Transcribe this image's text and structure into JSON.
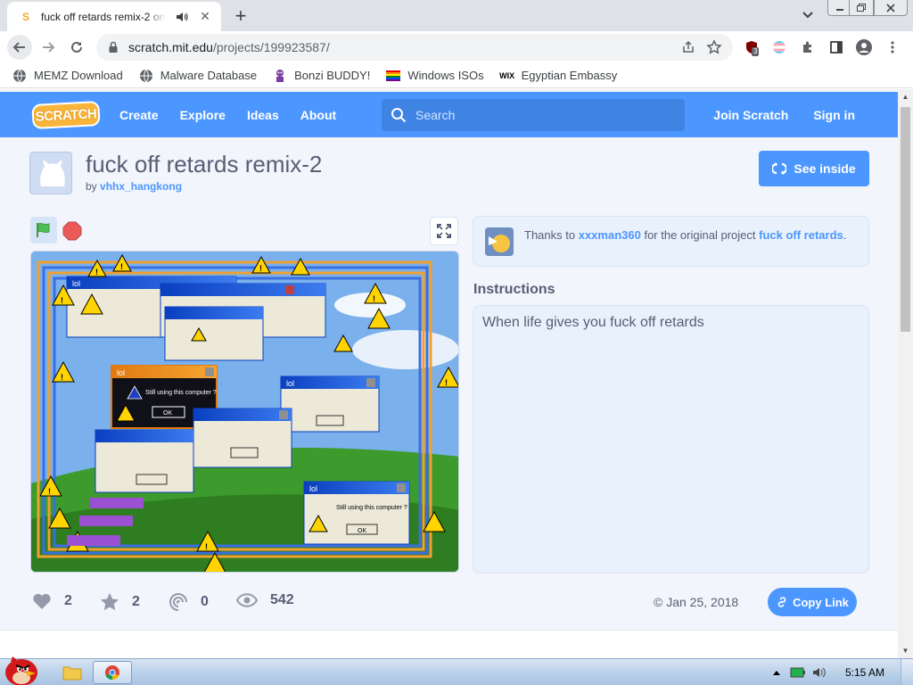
{
  "browser": {
    "tab": {
      "title": "fuck off retards remix-2 on Scratch"
    },
    "url": {
      "host": "scratch.mit.edu",
      "path": "/projects/199923587/"
    },
    "extension_badge": "3",
    "bookmarks": [
      {
        "label": "MEMZ Download",
        "icon": "globe-icon"
      },
      {
        "label": "Malware Database",
        "icon": "globe-icon"
      },
      {
        "label": "Bonzi BUDDY!",
        "icon": "bonzi-icon"
      },
      {
        "label": "Windows ISOs",
        "icon": "rainbow-flag-icon"
      },
      {
        "label": "Egyptian Embassy",
        "icon": "wix-icon"
      }
    ]
  },
  "scratch": {
    "logo": "SCRATCH",
    "nav": {
      "create": "Create",
      "explore": "Explore",
      "ideas": "Ideas",
      "about": "About",
      "join": "Join Scratch",
      "signin": "Sign in"
    },
    "search": {
      "placeholder": "Search"
    },
    "project": {
      "title": "fuck off retards remix-2",
      "by": "by",
      "author": "vhhx_hangkong",
      "see_inside": "See inside",
      "credits": {
        "prefix": "Thanks to",
        "user": "xxxman360",
        "middle": "for the original project",
        "original": "fuck off retards",
        "suffix": "."
      },
      "instructions_title": "Instructions",
      "instructions": "When life gives you fuck off retards",
      "stats": {
        "loves": "2",
        "favorites": "2",
        "remixes": "0",
        "views": "542"
      },
      "date": "Jan 25, 2018",
      "copy_link": "Copy Link"
    },
    "stage": {
      "windows": [
        {
          "title": "lol",
          "text": ""
        },
        {
          "title": "lol",
          "text": "Still using this computer ?",
          "button": "OK"
        },
        {
          "title": "lol",
          "text": "Still using this computer ?",
          "button": "OK"
        },
        {
          "title": "lol",
          "text": "Still using this computer ?",
          "button": "OK"
        }
      ]
    }
  },
  "taskbar": {
    "time": "5:15 AM"
  },
  "colors": {
    "scratch_blue": "#4c97ff",
    "scratch_text": "#575e75",
    "page_bg": "#f2f5fb"
  }
}
